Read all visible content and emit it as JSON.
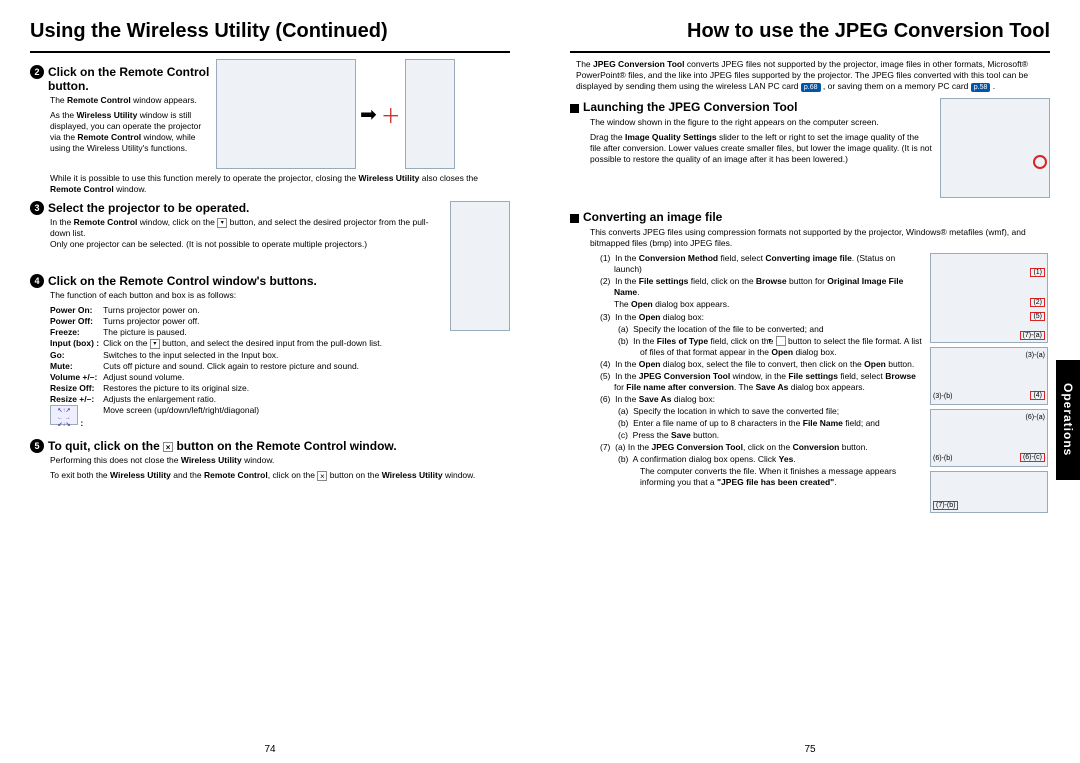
{
  "left": {
    "title": "Using the Wireless Utility (Continued)",
    "step2_title": "Click on the Remote Control button.",
    "step2_p1_a": "The ",
    "step2_p1_b": "Remote Control",
    "step2_p1_c": " window appears.",
    "step2_p2_a": "As the ",
    "step2_p2_b": "Wireless Utility",
    "step2_p2_c": " window is still displayed, you can operate the projector via the ",
    "step2_p2_d": "Remote Control",
    "step2_p2_e": " window, while using the Wireless Utility's functions.",
    "step2_note_a": "While it is possible to use this function merely to operate the projector, closing the ",
    "step2_note_b": "Wireless Utility",
    "step2_note_c": " also closes the ",
    "step2_note_d": "Remote Control",
    "step2_note_e": " window.",
    "step3_title": "Select the projector to be operated.",
    "step3_body_a": "In the ",
    "step3_body_b": "Remote Control",
    "step3_body_c": " window, click on the ",
    "step3_body_d": " button, and select the desired projector from the pull-down list.",
    "step3_body2": "Only one projector can be selected. (It is not possible to operate multiple projectors.)",
    "step4_title": "Click on the Remote Control window's buttons.",
    "step4_intro": "The function of each button and box is as follows:",
    "func": [
      [
        "Power On:",
        "Turns projector power on."
      ],
      [
        "Power Off:",
        "Turns projector power off."
      ],
      [
        "Freeze:",
        "The picture is paused."
      ],
      [
        "Input (box) :",
        "Click on the ▾ button, and select the desired input from the pull-down list."
      ],
      [
        "Go:",
        "Switches to the input selected in the Input box."
      ],
      [
        "Mute:",
        "Cuts off picture and sound. Click again to restore picture and sound."
      ],
      [
        "Volume +/–:",
        "Adjust sound volume."
      ],
      [
        "Resize Off:",
        "Restores the picture to its original size."
      ],
      [
        "Resize +/–:",
        "Adjusts the enlargement ratio."
      ],
      [
        "",
        "Move screen (up/down/left/right/diagonal)"
      ]
    ],
    "step5_title_a": "To quit, click on the ",
    "step5_title_b": " button on the Remote Control window.",
    "step5_body_a": "Performing this does not close the ",
    "step5_body_b": "Wireless Utility",
    "step5_body_c": " window.",
    "step5_body2_a": "To exit both the ",
    "step5_body2_b": "Wireless Utility",
    "step5_body2_c": " and the ",
    "step5_body2_d": "Remote Control",
    "step5_body2_e": ", click on the ",
    "step5_body2_f": " button on the ",
    "step5_body2_g": "Wireless Utility",
    "step5_body2_h": " window.",
    "pagenum": "74"
  },
  "right": {
    "title": "How to use the JPEG Conversion Tool",
    "intro_a": "The ",
    "intro_b": "JPEG Conversion Tool",
    "intro_c": " converts JPEG files not supported by the projector, image files in other formats, Microsoft® PowerPoint® files, and the like into JPEG files supported by the projector. The JPEG files converted with this tool can be displayed by sending them using the wireless LAN PC card ",
    "intro_d": " , or saving them on a memory PC card ",
    "intro_e": " .",
    "pref1": "p.68",
    "pref2": "p.58",
    "launch_title": "Launching the JPEG Conversion Tool",
    "launch_p1": "The window shown in the figure to the right appears on the computer screen.",
    "launch_p2_a": "Drag the ",
    "launch_p2_b": "Image Quality Settings",
    "launch_p2_c": " slider to the left or right to set the image quality of the file after conversion. Lower values create smaller files, but lower the image quality. (It is not possible to restore the quality of an image after it has been lowered.)",
    "convert_title": "Converting an image file",
    "convert_intro": "This converts JPEG files using compression formats not supported by the projector, Windows® metafiles (wmf), and bitmapped files (bmp) into JPEG files.",
    "steps": [
      {
        "n": "(1)",
        "a": "In the ",
        "b": "Conversion Method",
        "c": " field, select ",
        "d": "Converting image file",
        "e": ". (Status on launch)"
      },
      {
        "n": "(2)",
        "a": "In the ",
        "b": "File settings",
        "c": " field, click on the ",
        "d": "Browse",
        "e": " button for ",
        "f": "Original Image File Name",
        "g": "."
      },
      {
        "n": "",
        "plain": "The Open dialog box appears.",
        "pb": "Open"
      },
      {
        "n": "(3)",
        "a": "In the ",
        "b": "Open",
        "c": " dialog box:"
      },
      {
        "n": "(a)",
        "sub": true,
        "plain": "Specify the location of the file to be converted; and"
      },
      {
        "n": "(b)",
        "sub": true,
        "a": "In the ",
        "b": "Files of Type",
        "c": " field, click on the ",
        "dd": true,
        "e": " button to select the file format. A list of files of that format appear in the ",
        "f": "Open",
        "g": " dialog box."
      },
      {
        "n": "(4)",
        "a": "In the ",
        "b": "Open",
        "c": " dialog box, select the file to convert, then click on the ",
        "d": "Open",
        "e": " button."
      },
      {
        "n": "(5)",
        "a": "In the ",
        "b": "JPEG Conversion Tool",
        "c": " window, in the ",
        "d": "File settings",
        "e": " field, select ",
        "f": "Browse",
        "g": " for ",
        "h": "File name after conversion",
        "i": ". The ",
        "j": "Save As",
        "k": " dialog box appears."
      },
      {
        "n": "(6)",
        "a": "In the ",
        "b": "Save As",
        "c": " dialog box:"
      },
      {
        "n": "(a)",
        "sub": true,
        "plain": "Specify the location in which to save the converted file;"
      },
      {
        "n": "(b)",
        "sub": true,
        "a": "Enter a file name of up to 8 characters in the ",
        "b": "File Name",
        "c": " field; and"
      },
      {
        "n": "(c)",
        "sub": true,
        "a": "Press the ",
        "b": "Save",
        "c": " button."
      },
      {
        "n": "(7)",
        "a": "(a) In the ",
        "b": "JPEG Conversion Tool",
        "c": ", click on the ",
        "d": "Conversion",
        "e": " button."
      },
      {
        "n": "(b)",
        "sub": true,
        "a": "A confirmation dialog box opens. Click ",
        "b": "Yes",
        "c": "."
      },
      {
        "n": "",
        "sub": true,
        "plain": "The computer converts the file. When it finishes a message  appears informing you that a ",
        "pb": "\"JPEG file has been created\"",
        "post": "."
      }
    ],
    "pagenum": "75",
    "sidetab": "Operations"
  }
}
